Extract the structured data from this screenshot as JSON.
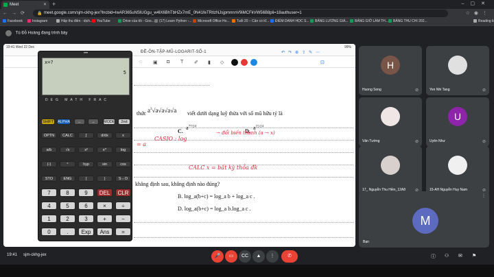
{
  "browser": {
    "tab_title": "Meet",
    "url": "meet.google.com/sjm-ckhg-jex?lncbid=IwAR365uNSlUGgu_w4lX6BhTbHZx7mE_0N41feTRtlzNJsjpmnnnV9iMCFkVW56B8pli=18authuser=1",
    "bookmarks": [
      "Facebook",
      "Instagram",
      "Hấp thu điền - dịch...",
      "YouTube",
      "Drive của tôi - Goo...",
      "(17) Learn Python -...",
      "Microsoft Office Ho...",
      "Tuổi 20 – Cân có kĩ...",
      "ĐIỂM DANH HỌC S...",
      "BẢNG LƯƠNG GIÁ...",
      "BẢNG GIỜ LÀM TH...",
      "BẢNG THU CHI 202...",
      "Reading list"
    ]
  },
  "meet": {
    "presenting_label": "Tú Đỗ Hoàng đang trình bày",
    "meeting_code": "sjm-ckhg-jex",
    "time": "19:41",
    "presenter_name": "Tú Đỗ...",
    "participants": [
      {
        "name": "Huong Song",
        "initial": "H",
        "color": "#795548"
      },
      {
        "name": "Yen Nhi Tang",
        "initial": "",
        "color": "#e0e0e0"
      },
      {
        "name": "Vân Tường",
        "initial": "",
        "color": "#f0e6e6"
      },
      {
        "name": "Uyên Như",
        "initial": "U",
        "color": "#8e24aa"
      },
      {
        "name": "17_ Nguyễn Thu Hiền_12A8",
        "initial": "",
        "color": "#d8d0cc"
      },
      {
        "name": "15-AH Nguyễn Huy Nam",
        "initial": "",
        "color": "#f0f0f0"
      }
    ],
    "self": {
      "name": "Bạn",
      "initial": "M"
    }
  },
  "doc": {
    "status_left": "19:41   Wed 22 Dec",
    "status_right": "99%",
    "filename": "ĐỀ-ÔN-TẬP-MŨ-LOGARIT-SỐ-1",
    "question_fragment": "thức",
    "question_text": "viết dưới dạng luỹ thừa với số mũ hữu tỷ là",
    "option_c": "C.",
    "option_d": "D.",
    "question2": "khẳng định sau, khẳng định nào đúng?",
    "option_b": "B.  log_a(b+c) = log_a b + log_a c .",
    "option_d2": "D.  log_a(b+c) = log_a b.log_a c .",
    "handwriting": [
      "CASIO : log",
      "→ đổi biến thành (a → x)",
      "CALC    x = bất kỳ thỏa đk",
      "= a"
    ]
  },
  "calculator": {
    "input": "x=?",
    "output": "5",
    "brand": "DEG MATH FRAC"
  }
}
